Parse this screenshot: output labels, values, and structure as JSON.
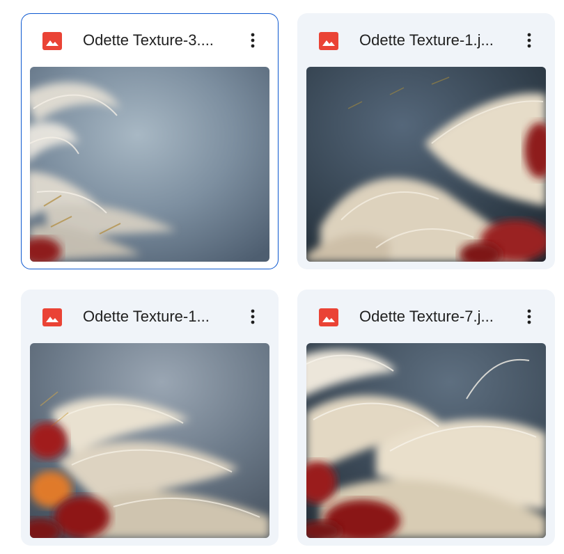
{
  "icons": {
    "file_type": "image-file-icon",
    "menu": "more-vert-icon"
  },
  "colors": {
    "image_icon_red": "#ea4335",
    "selected_border": "#0b57d0",
    "card_background": "#f0f4f9"
  },
  "files": [
    {
      "name": "Odette Texture-3....",
      "selected": true
    },
    {
      "name": "Odette Texture-1.j...",
      "selected": false
    },
    {
      "name": "Odette Texture-1...",
      "selected": false
    },
    {
      "name": "Odette Texture-7.j...",
      "selected": false
    }
  ]
}
